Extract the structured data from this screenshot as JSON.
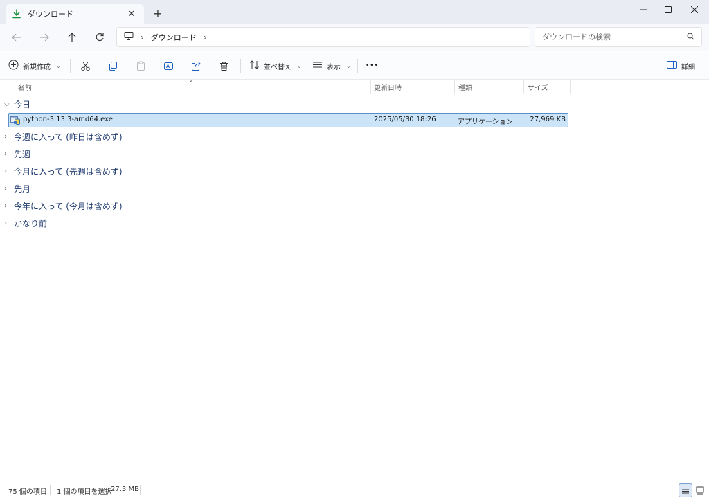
{
  "tab": {
    "title": "ダウンロード",
    "close": "✕",
    "new_tab": "+"
  },
  "address": {
    "crumbs": [
      "ダウンロード"
    ],
    "sep1": "›",
    "sep2": "›"
  },
  "search": {
    "placeholder": "ダウンロードの検索"
  },
  "toolbar": {
    "new_label": "新規作成",
    "sort_label": "並べ替え",
    "view_label": "表示",
    "more_label": "•••",
    "details_label": "詳細"
  },
  "columns": {
    "name": "名前",
    "date": "更新日時",
    "type": "種類",
    "size": "サイズ"
  },
  "groups": {
    "today": "今日",
    "this_week": "今週に入って (昨日は含めず)",
    "last_week": "先週",
    "this_month": "今月に入って (先週は含めず)",
    "last_month": "先月",
    "this_year": "今年に入って (今月は含めず)",
    "long_ago": "かなり前"
  },
  "file": {
    "name": "python-3.13.3-amd64.exe",
    "date": "2025/05/30 18:26",
    "type": "アプリケーション",
    "size": "27,969 KB"
  },
  "status": {
    "count": "75 個の項目",
    "selected": "1 個の項目を選択",
    "selected_size": "27.3 MB"
  },
  "colors": {
    "accent": "#0f7b0f",
    "selection": "#cce4f7",
    "group_text": "#1f3a6e"
  }
}
